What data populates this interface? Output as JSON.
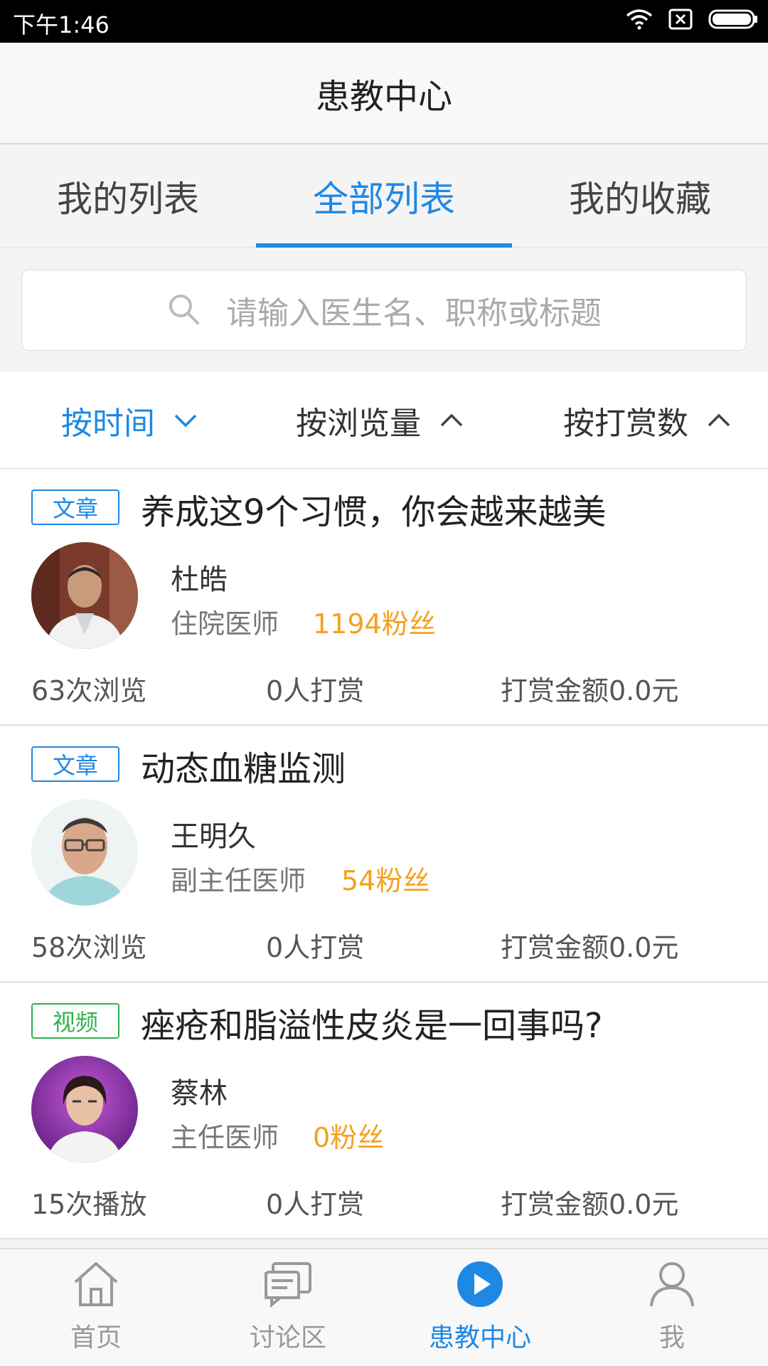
{
  "status_bar": {
    "time": "下午1:46"
  },
  "header": {
    "title": "患教中心"
  },
  "tabs": [
    {
      "label": "我的列表"
    },
    {
      "label": "全部列表"
    },
    {
      "label": "我的收藏"
    }
  ],
  "search": {
    "placeholder": "请输入医生名、职称或标题"
  },
  "sort": [
    {
      "label": "按时间"
    },
    {
      "label": "按浏览量"
    },
    {
      "label": "按打赏数"
    }
  ],
  "articles": [
    {
      "tag": "文章",
      "title": "养成这9个习惯，你会越来越美",
      "author": "杜皓",
      "author_title": "住院医师",
      "fans": "1194粉丝",
      "views": "63次浏览",
      "rewards": "0人打赏",
      "amount": "打赏金额0.0元"
    },
    {
      "tag": "文章",
      "title": "动态血糖监测",
      "author": "王明久",
      "author_title": "副主任医师",
      "fans": "54粉丝",
      "views": "58次浏览",
      "rewards": "0人打赏",
      "amount": "打赏金额0.0元"
    },
    {
      "tag": "视频",
      "title": "痤疮和脂溢性皮炎是一回事吗?",
      "author": "蔡林",
      "author_title": "主任医师",
      "fans": "0粉丝",
      "views": "15次播放",
      "rewards": "0人打赏",
      "amount": "打赏金额0.0元"
    }
  ],
  "bottom_nav": [
    {
      "label": "首页",
      "icon": "home-icon"
    },
    {
      "label": "讨论区",
      "icon": "chat-icon"
    },
    {
      "label": "患教中心",
      "icon": "play-icon"
    },
    {
      "label": "我",
      "icon": "person-icon"
    }
  ],
  "colors": {
    "accent": "#1e88e5",
    "fans": "#f5a01e",
    "video_tag": "#2db34a"
  }
}
